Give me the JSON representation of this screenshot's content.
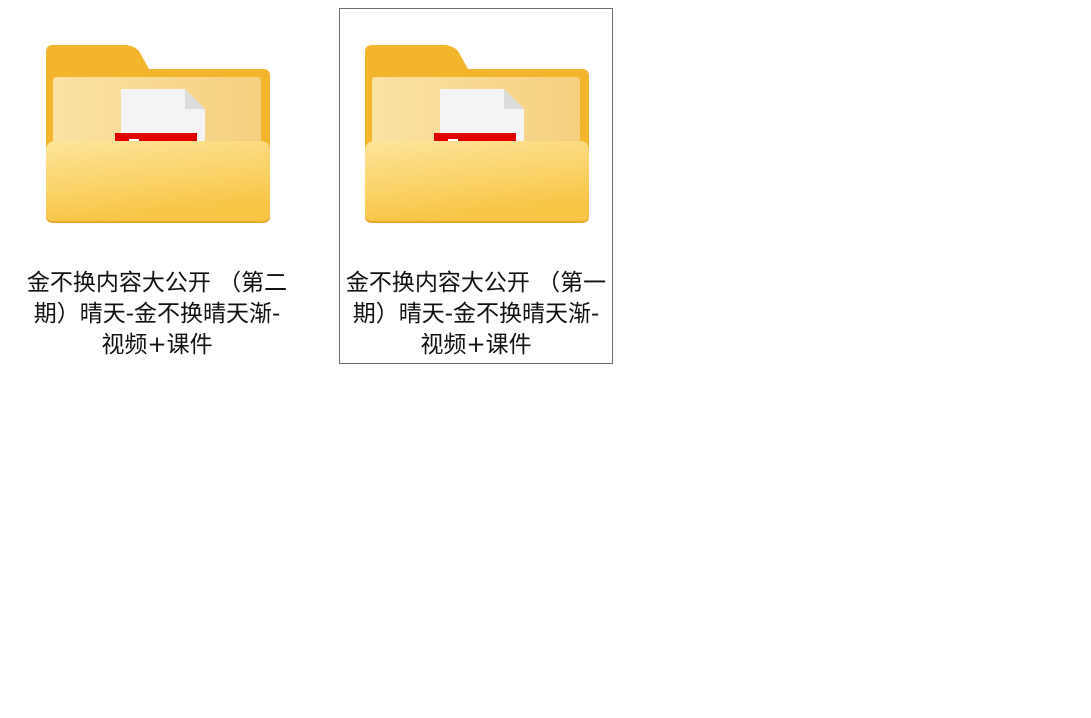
{
  "items": [
    {
      "label": "金不换内容大公开 （第二期）晴天-金不换晴天渐-视频+课件",
      "icon": "folder-icon",
      "selected": false
    },
    {
      "label": "金不换内容大公开 （第一期）晴天-金不换晴天渐-视频+课件",
      "icon": "folder-icon",
      "selected": true
    }
  ],
  "colors": {
    "folder_back": "#f3b52b",
    "folder_front_top": "#fde18a",
    "folder_front_bottom": "#f8c544",
    "pdf_red": "#e00000",
    "selection_border": "#6e6e6e"
  }
}
